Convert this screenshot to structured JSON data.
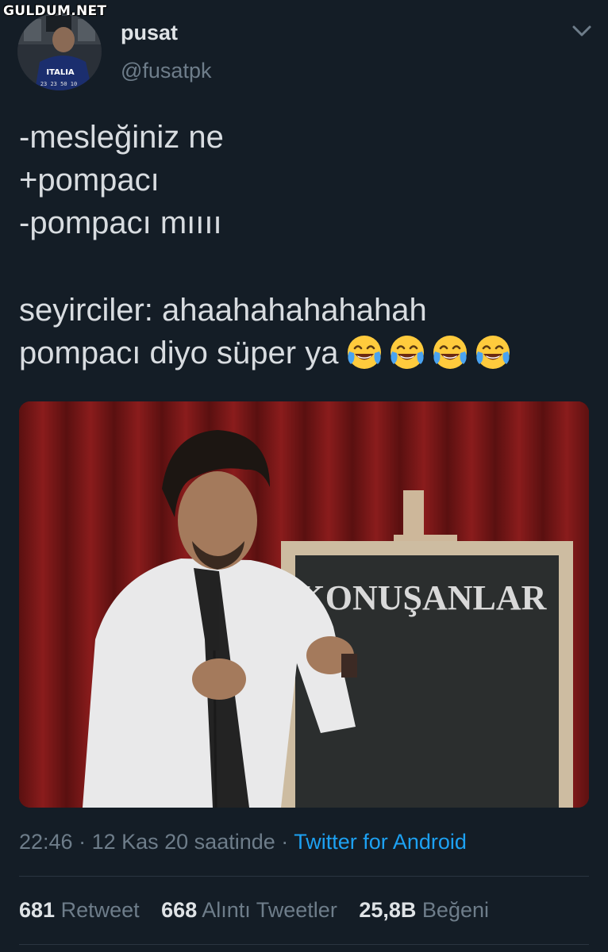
{
  "watermark": "GULDUM.NET",
  "author": {
    "display_name": "pusat",
    "handle": "@fusatpk",
    "avatar_icon": "profile-photo"
  },
  "menu_icon": "chevron-down-icon",
  "tweet": {
    "lines": [
      "-mesleğiniz ne",
      "+pompacı",
      "-pompacı mıııı"
    ],
    "lines2": [
      "seyirciler: ahaahahahahahah",
      "pompacı diyo süper ya"
    ],
    "emoji": "face-with-tears-of-joy",
    "emoji_count": 4
  },
  "media": {
    "board_text": "KONUŞANLAR"
  },
  "meta": {
    "time": "22:46",
    "separator1": " · ",
    "date": "12 Kas 20 saatinde",
    "separator2": " · ",
    "source": "Twitter for Android"
  },
  "stats": {
    "retweets": {
      "count": "681",
      "label": "Retweet"
    },
    "quotes": {
      "count": "668",
      "label": "Alıntı Tweetler"
    },
    "likes": {
      "count": "25,8B",
      "label": "Beğeni"
    }
  },
  "colors": {
    "background": "#141d26",
    "text": "#d8dce0",
    "secondary": "#6e7d8a",
    "link": "#1da1f2"
  }
}
